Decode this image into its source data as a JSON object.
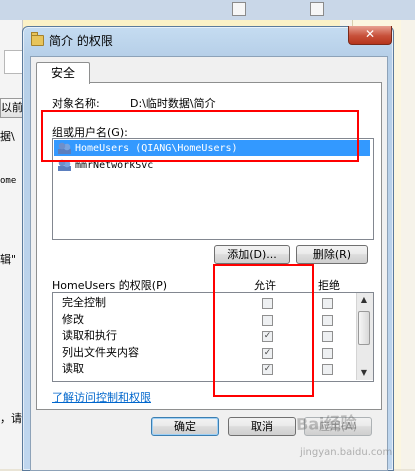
{
  "background": {
    "fragments": [
      "以前",
      "据\\",
      "ome",
      "辑\"",
      "，请"
    ]
  },
  "dialog": {
    "title": "简介 的权限",
    "close_glyph": "✕",
    "tab_label": "安全",
    "object_name_label": "对象名称:",
    "object_name_value": "D:\\临时数据\\简介",
    "groups_label": "组或用户名(G):",
    "users": [
      {
        "name": "HomeUsers (QIANG\\HomeUsers)",
        "selected": true
      },
      {
        "name": "mmrNetworkSvc",
        "selected": false
      }
    ],
    "add_button": "添加(D)...",
    "remove_button": "删除(R)",
    "permissions_label": "HomeUsers 的权限(P)",
    "allow_header": "允许",
    "deny_header": "拒绝",
    "permissions": [
      {
        "name": "完全控制",
        "allow": false,
        "deny": false
      },
      {
        "name": "修改",
        "allow": false,
        "deny": false
      },
      {
        "name": "读取和执行",
        "allow": true,
        "deny": false
      },
      {
        "name": "列出文件夹内容",
        "allow": true,
        "deny": false
      },
      {
        "name": "读取",
        "allow": true,
        "deny": false
      }
    ],
    "advanced_link": "了解访问控制和权限",
    "ok_button": "确定",
    "cancel_button": "取消",
    "apply_button": "应用(A)"
  },
  "watermark": {
    "text": "Bai经验",
    "url": "jingyan.baidu.com"
  },
  "colors": {
    "selection": "#3399ff",
    "annotation": "#ff0000",
    "link": "#0066cc"
  }
}
